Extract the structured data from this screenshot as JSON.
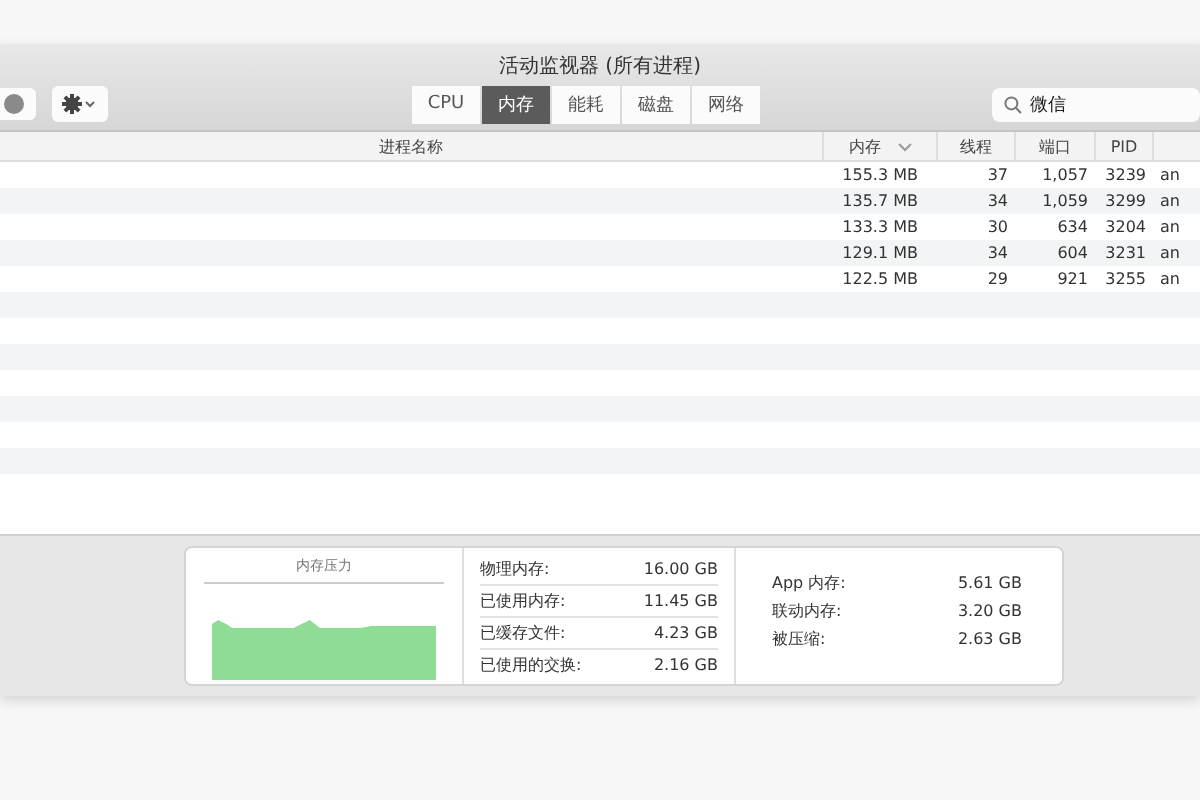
{
  "window": {
    "title": "活动监视器 (所有进程)"
  },
  "tabs": [
    {
      "label": "CPU",
      "selected": false
    },
    {
      "label": "内存",
      "selected": true
    },
    {
      "label": "能耗",
      "selected": false
    },
    {
      "label": "磁盘",
      "selected": false
    },
    {
      "label": "网络",
      "selected": false
    }
  ],
  "search": {
    "value": "微信"
  },
  "table": {
    "columns": [
      {
        "label": "进程名称",
        "sorted": false
      },
      {
        "label": "内存",
        "sorted": true
      },
      {
        "label": "线程",
        "sorted": false
      },
      {
        "label": "端口",
        "sorted": false
      },
      {
        "label": "PID",
        "sorted": false
      }
    ],
    "rows": [
      {
        "memory": "155.3 MB",
        "threads": "37",
        "ports": "1,057",
        "pid": "3239",
        "user": "an"
      },
      {
        "memory": "135.7 MB",
        "threads": "34",
        "ports": "1,059",
        "pid": "3299",
        "user": "an"
      },
      {
        "memory": "133.3 MB",
        "threads": "30",
        "ports": "634",
        "pid": "3204",
        "user": "an"
      },
      {
        "memory": "129.1 MB",
        "threads": "34",
        "ports": "604",
        "pid": "3231",
        "user": "an"
      },
      {
        "memory": "122.5 MB",
        "threads": "29",
        "ports": "921",
        "pid": "3255",
        "user": "an"
      }
    ]
  },
  "memory_pressure": {
    "title": "内存压力"
  },
  "stats": [
    {
      "label": "物理内存:",
      "value": "16.00 GB"
    },
    {
      "label": "已使用内存:",
      "value": "11.45 GB"
    },
    {
      "label": "已缓存文件:",
      "value": "4.23 GB"
    },
    {
      "label": "已使用的交换:",
      "value": "2.16 GB"
    }
  ],
  "app_stats": [
    {
      "label": "App 内存:",
      "value": "5.61 GB"
    },
    {
      "label": "联动内存:",
      "value": "3.20 GB"
    },
    {
      "label": "被压缩:",
      "value": "2.63 GB"
    }
  ]
}
